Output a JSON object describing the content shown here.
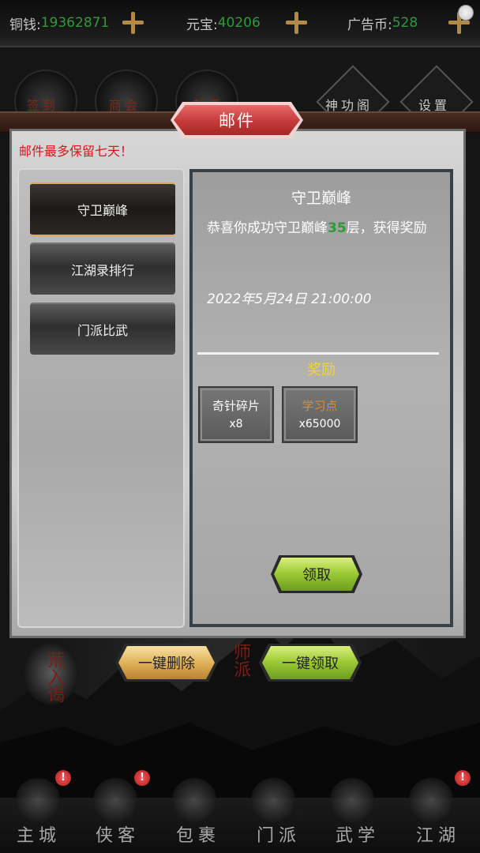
{
  "currency": {
    "copper_label": "铜钱:",
    "copper_value": "19362871",
    "yuanbao_label": "元宝:",
    "yuanbao_value": "40206",
    "adcoin_label": "广告币:",
    "adcoin_value": "528"
  },
  "top_menu": {
    "items": [
      "签到",
      "商会",
      "新手",
      "神功阁",
      "设置"
    ]
  },
  "dialog": {
    "title": "邮件",
    "notice": "邮件最多保留七天！",
    "mail_list": [
      "守卫巅峰",
      "江湖录排行",
      "门派比武"
    ],
    "selected_index": 0,
    "mail": {
      "title": "守卫巅峰",
      "body_prefix": "恭喜你成功守卫巅峰",
      "body_highlight": "35",
      "body_suffix": "层，获得奖励",
      "date": "2022年5月24日 21:00:00",
      "reward_header": "奖励",
      "rewards": [
        {
          "name": "奇针碎片",
          "qty": "x8"
        },
        {
          "name": "学习点",
          "qty": "x65000"
        }
      ],
      "claim_label": "领取"
    },
    "delete_all_label": "一键删除",
    "claim_all_label": "一键领取"
  },
  "background_deco": {
    "left_text": "荒入谒",
    "mid_text": "师派"
  },
  "bottom_nav": {
    "items": [
      "主城",
      "侠客",
      "包裹",
      "门派",
      "武学",
      "江湖"
    ],
    "badge": "!"
  },
  "colors": {
    "green_value": "#2f9a3a",
    "reward_gold": "#f1d530",
    "notice_red": "#d01c1c",
    "title_red": "#c43a3a"
  }
}
